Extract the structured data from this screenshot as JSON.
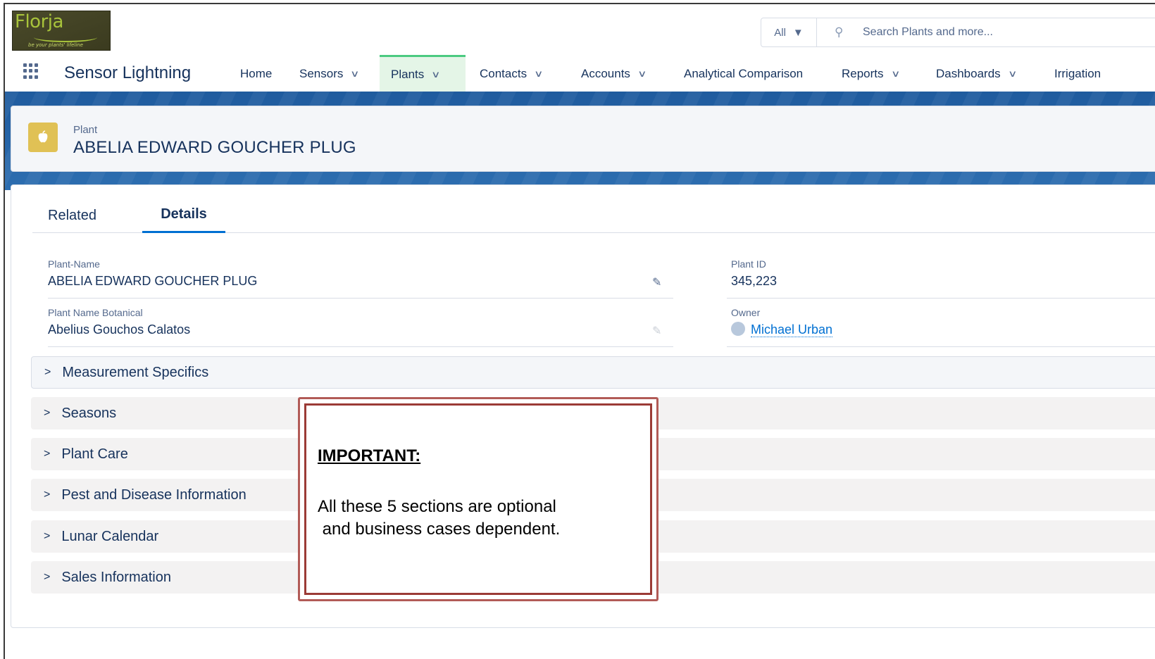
{
  "logo": {
    "name": "Florja",
    "tagline": "be your plants' lifeline"
  },
  "search": {
    "scope": "All",
    "placeholder": "Search Plants and more..."
  },
  "nav": {
    "app_name": "Sensor Lightning",
    "items": [
      {
        "label": "Home"
      },
      {
        "label": "Sensors"
      },
      {
        "label": "Plants"
      },
      {
        "label": "Contacts"
      },
      {
        "label": "Accounts"
      },
      {
        "label": "Analytical Comparison"
      },
      {
        "label": "Reports"
      },
      {
        "label": "Dashboards"
      },
      {
        "label": "Irrigation"
      }
    ]
  },
  "record": {
    "type": "Plant",
    "title": "ABELIA EDWARD GOUCHER PLUG",
    "icon": "apple-icon",
    "icon_color": "#e0c155"
  },
  "tabs": [
    {
      "label": "Related"
    },
    {
      "label": "Details"
    }
  ],
  "fields": {
    "plant_name": {
      "label": "Plant-Name",
      "value": "ABELIA EDWARD GOUCHER PLUG"
    },
    "plant_id": {
      "label": "Plant ID",
      "value": "345,223"
    },
    "botanical": {
      "label": "Plant Name Botanical",
      "value": "Abelius Gouchos Calatos"
    },
    "owner": {
      "label": "Owner",
      "value": "Michael Urban"
    }
  },
  "sections": [
    {
      "label": "Measurement Specifics"
    },
    {
      "label": "Seasons"
    },
    {
      "label": "Plant Care"
    },
    {
      "label": "Pest and Disease Information"
    },
    {
      "label": "Lunar Calendar"
    },
    {
      "label": "Sales Information"
    }
  ],
  "note": {
    "title": "IMPORTANT:",
    "body": "All these 5 sections are optional\n and business cases dependent."
  },
  "colors": {
    "accent": "#0070d2",
    "active_nav": "#4bca81",
    "banner": "#1f5b9e",
    "note_border": "#9b3b36"
  }
}
